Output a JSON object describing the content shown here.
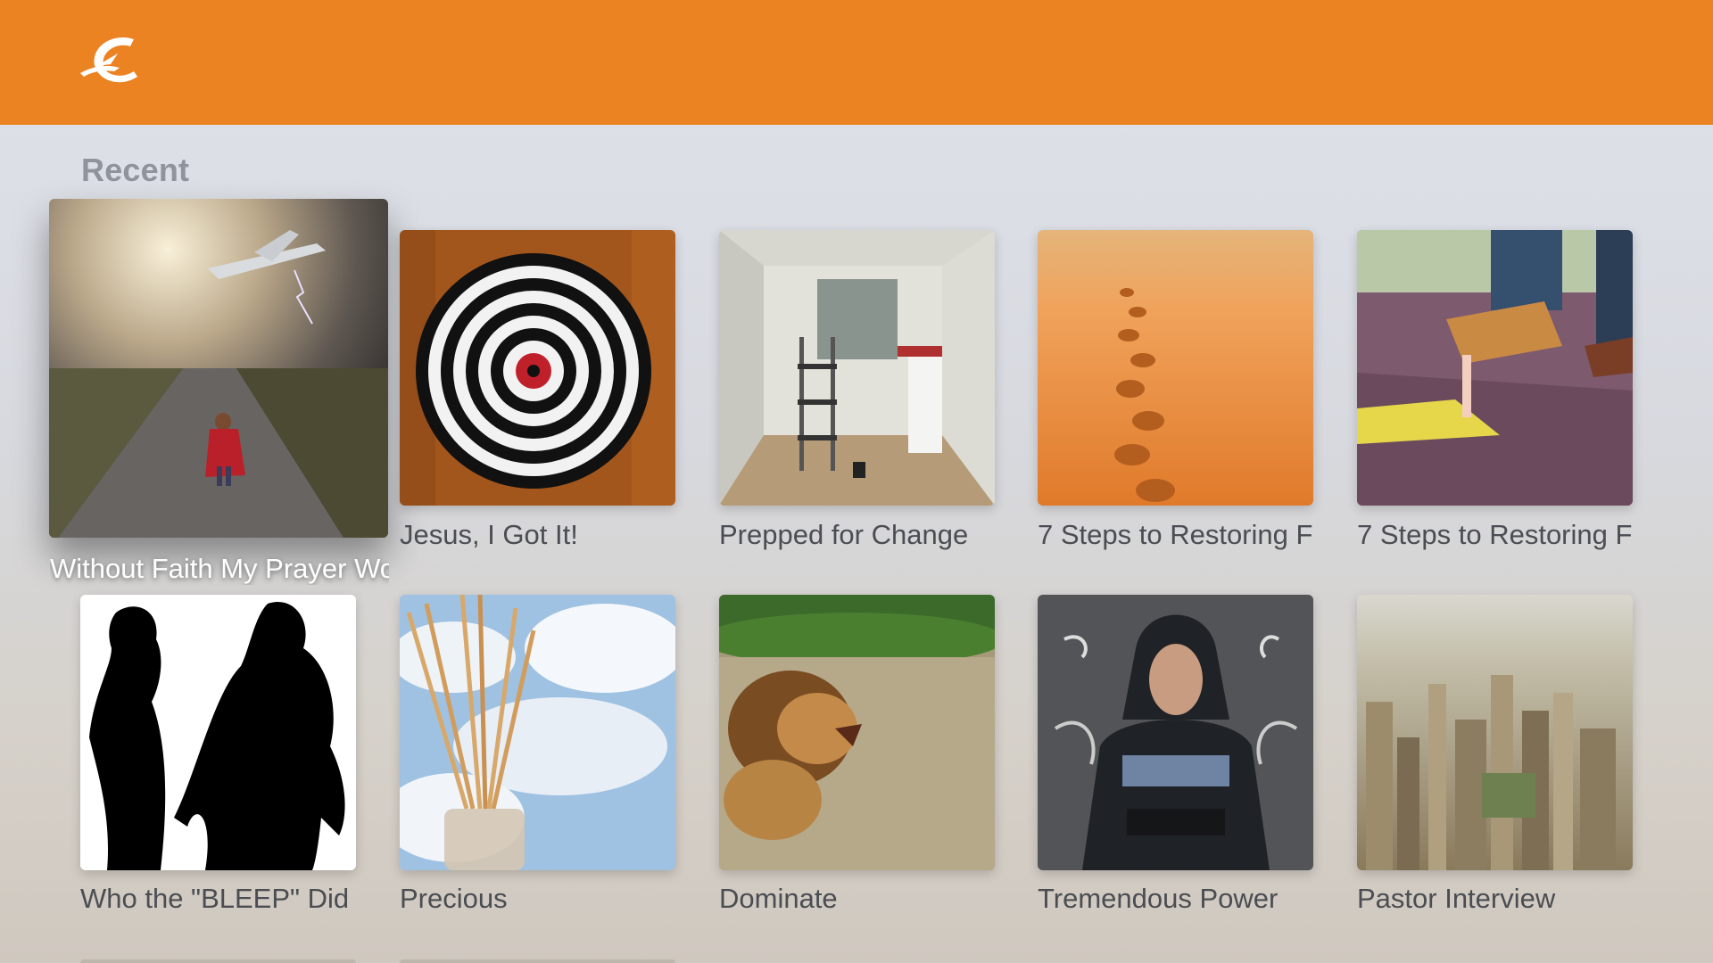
{
  "app": {
    "logo_icon": "church-c-logo-icon",
    "brand_color": "#ec8323"
  },
  "section": {
    "title": "Recent"
  },
  "items": [
    {
      "title": "Without Faith My Prayer Wo",
      "image": "storm-road-child-plane-image",
      "focused": true
    },
    {
      "title": "Jesus, I Got It!",
      "image": "dartboard-image"
    },
    {
      "title": "Prepped for Change",
      "image": "kitchen-renovation-image"
    },
    {
      "title": "7 Steps to Restoring F",
      "image": "desert-footprints-image"
    },
    {
      "title": "7 Steps to Restoring F",
      "image": "gum-shoe-image"
    },
    {
      "title": "Who the \"BLEEP\" Did",
      "image": "silhouettes-image"
    },
    {
      "title": "Precious",
      "image": "reed-diffuser-image"
    },
    {
      "title": "Dominate",
      "image": "lion-image"
    },
    {
      "title": "Tremendous Power",
      "image": "hooded-man-image"
    },
    {
      "title": "Pastor Interview",
      "image": "city-aerial-image"
    }
  ]
}
